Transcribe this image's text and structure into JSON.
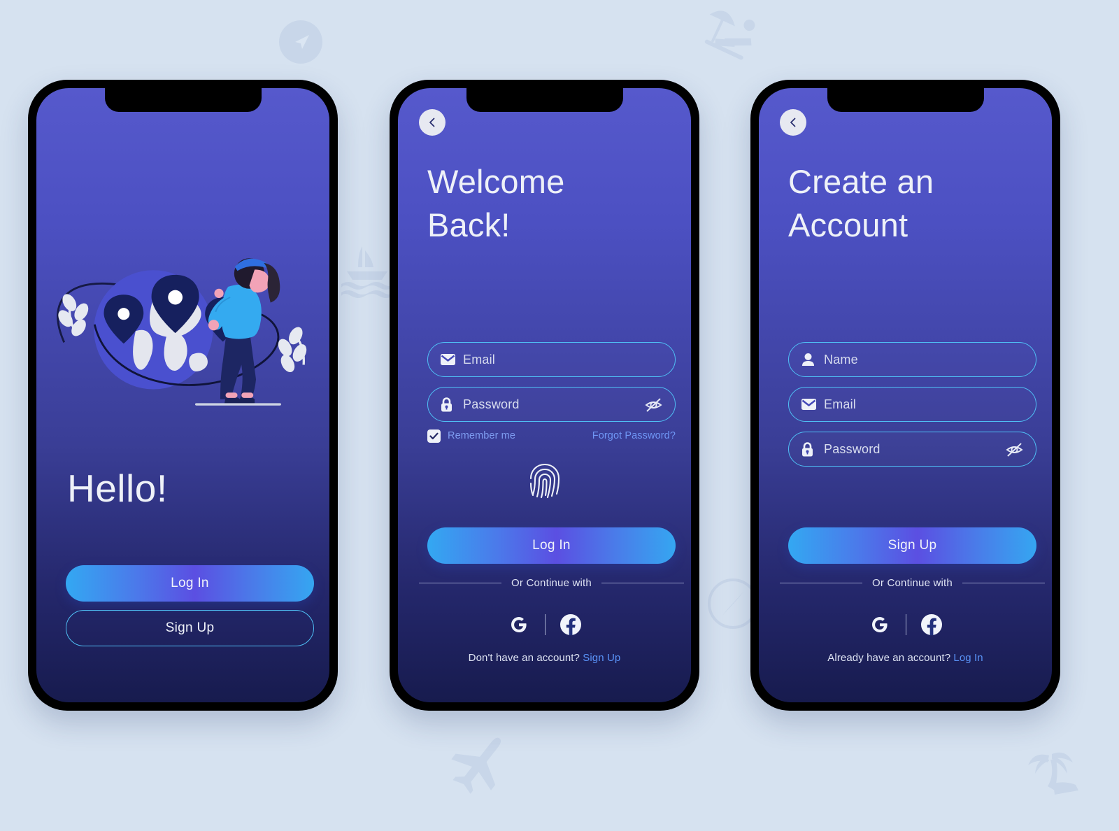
{
  "theme": {
    "page_background": "#d6e2f0",
    "screen_gradient_top": "#5659cc",
    "screen_gradient_bottom": "#171b4e",
    "accent_cyan": "#4fc0f5",
    "accent_link": "#5a93f8",
    "button_gradient": [
      "#33a8f2",
      "#5b4fe2",
      "#35a6f1"
    ],
    "bezel": "#000000"
  },
  "background_watermarks": [
    {
      "name": "send-arrow-watermark"
    },
    {
      "name": "beach-lounger-watermark"
    },
    {
      "name": "sailboat-watermark"
    },
    {
      "name": "airplane-watermark"
    },
    {
      "name": "compass-watermark"
    },
    {
      "name": "palm-tree-watermark"
    }
  ],
  "screens": [
    {
      "id": "welcome",
      "illustration": "woman-with-globe-and-map-pins",
      "greeting": "Hello!",
      "buttons": {
        "primary": "Log In",
        "secondary": "Sign Up"
      }
    },
    {
      "id": "login",
      "back_icon": "chevron-left-icon",
      "title": "Welcome\nBack!",
      "title_line1": "Welcome",
      "title_line2": "Back!",
      "fields": [
        {
          "icon": "envelope-icon",
          "placeholder": "Email",
          "value": "",
          "has_eye": false
        },
        {
          "icon": "lock-icon",
          "placeholder": "Password",
          "value": "",
          "has_eye": true,
          "eye_icon": "eye-off-icon"
        }
      ],
      "remember": {
        "label": "Remember me",
        "checked": true
      },
      "forgot": "Forgot Password?",
      "biometric_icon": "fingerprint-icon",
      "submit": "Log In",
      "divider": "Or Continue with",
      "socials": [
        {
          "name": "google-icon",
          "label": "G"
        },
        {
          "name": "facebook-icon",
          "label": "f"
        }
      ],
      "footer_text": "Don't have an account? ",
      "footer_link": "Sign Up"
    },
    {
      "id": "signup",
      "back_icon": "chevron-left-icon",
      "title_line1": "Create an",
      "title_line2": "Account",
      "fields": [
        {
          "icon": "person-icon",
          "placeholder": "Name",
          "value": "",
          "has_eye": false
        },
        {
          "icon": "envelope-icon",
          "placeholder": "Email",
          "value": "",
          "has_eye": false
        },
        {
          "icon": "lock-icon",
          "placeholder": "Password",
          "value": "",
          "has_eye": true,
          "eye_icon": "eye-off-icon"
        }
      ],
      "submit": "Sign Up",
      "divider": "Or Continue with",
      "socials": [
        {
          "name": "google-icon",
          "label": "G"
        },
        {
          "name": "facebook-icon",
          "label": "f"
        }
      ],
      "footer_text": "Already have an account? ",
      "footer_link": "Log In"
    }
  ]
}
